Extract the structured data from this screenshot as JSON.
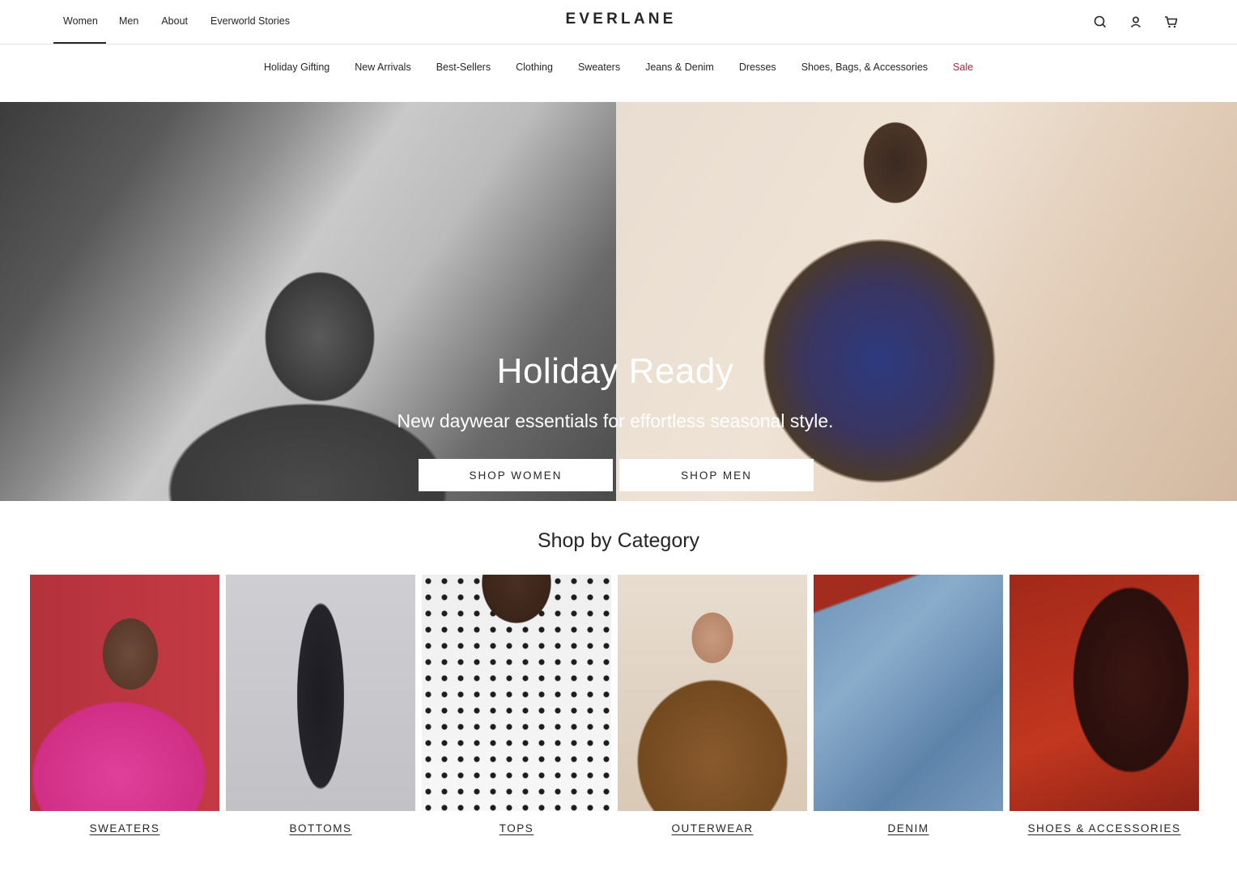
{
  "header": {
    "primary_nav": [
      "Women",
      "Men",
      "About",
      "Everworld Stories"
    ],
    "active_primary": "Women",
    "logo": "EVERLANE",
    "utility_icons": [
      "search-icon",
      "account-icon",
      "cart-icon"
    ]
  },
  "subnav": {
    "items": [
      "Holiday Gifting",
      "New Arrivals",
      "Best-Sellers",
      "Clothing",
      "Sweaters",
      "Jeans & Denim",
      "Dresses",
      "Shoes, Bags, & Accessories",
      "Sale"
    ],
    "sale_color": "#b1243a"
  },
  "hero": {
    "title": "Holiday Ready",
    "subtitle": "New daywear essentials for effortless seasonal style.",
    "buttons": [
      "SHOP WOMEN",
      "SHOP MEN"
    ]
  },
  "categories": {
    "title": "Shop by Category",
    "items": [
      "SWEATERS",
      "BOTTOMS",
      "TOPS",
      "OUTERWEAR",
      "DENIM",
      "SHOES & ACCESSORIES"
    ]
  }
}
